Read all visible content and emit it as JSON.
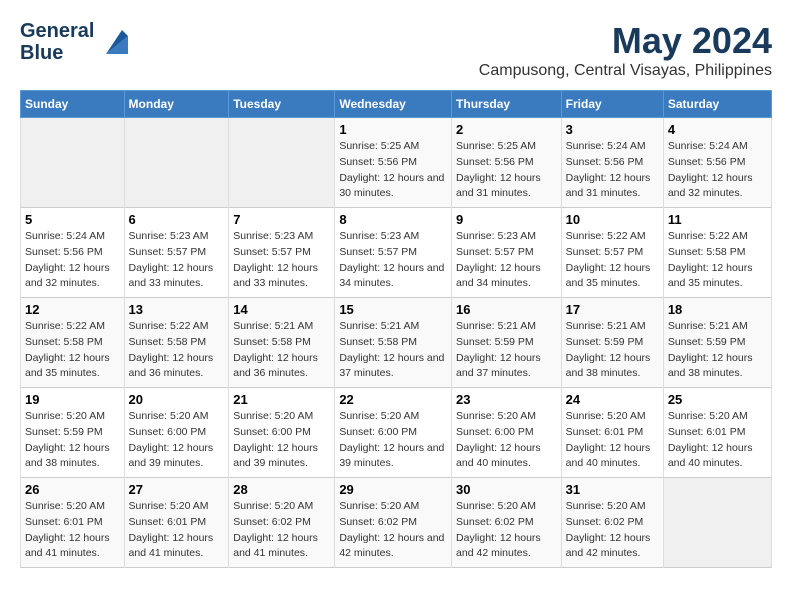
{
  "logo": {
    "line1": "General",
    "line2": "Blue"
  },
  "title": "May 2024",
  "subtitle": "Campusong, Central Visayas, Philippines",
  "days_of_week": [
    "Sunday",
    "Monday",
    "Tuesday",
    "Wednesday",
    "Thursday",
    "Friday",
    "Saturday"
  ],
  "weeks": [
    [
      {
        "day": "",
        "sunrise": "",
        "sunset": "",
        "daylight": "",
        "empty": true
      },
      {
        "day": "",
        "sunrise": "",
        "sunset": "",
        "daylight": "",
        "empty": true
      },
      {
        "day": "",
        "sunrise": "",
        "sunset": "",
        "daylight": "",
        "empty": true
      },
      {
        "day": "1",
        "sunrise": "5:25 AM",
        "sunset": "5:56 PM",
        "daylight": "12 hours and 30 minutes."
      },
      {
        "day": "2",
        "sunrise": "5:25 AM",
        "sunset": "5:56 PM",
        "daylight": "12 hours and 31 minutes."
      },
      {
        "day": "3",
        "sunrise": "5:24 AM",
        "sunset": "5:56 PM",
        "daylight": "12 hours and 31 minutes."
      },
      {
        "day": "4",
        "sunrise": "5:24 AM",
        "sunset": "5:56 PM",
        "daylight": "12 hours and 32 minutes."
      }
    ],
    [
      {
        "day": "5",
        "sunrise": "5:24 AM",
        "sunset": "5:56 PM",
        "daylight": "12 hours and 32 minutes."
      },
      {
        "day": "6",
        "sunrise": "5:23 AM",
        "sunset": "5:57 PM",
        "daylight": "12 hours and 33 minutes."
      },
      {
        "day": "7",
        "sunrise": "5:23 AM",
        "sunset": "5:57 PM",
        "daylight": "12 hours and 33 minutes."
      },
      {
        "day": "8",
        "sunrise": "5:23 AM",
        "sunset": "5:57 PM",
        "daylight": "12 hours and 34 minutes."
      },
      {
        "day": "9",
        "sunrise": "5:23 AM",
        "sunset": "5:57 PM",
        "daylight": "12 hours and 34 minutes."
      },
      {
        "day": "10",
        "sunrise": "5:22 AM",
        "sunset": "5:57 PM",
        "daylight": "12 hours and 35 minutes."
      },
      {
        "day": "11",
        "sunrise": "5:22 AM",
        "sunset": "5:58 PM",
        "daylight": "12 hours and 35 minutes."
      }
    ],
    [
      {
        "day": "12",
        "sunrise": "5:22 AM",
        "sunset": "5:58 PM",
        "daylight": "12 hours and 35 minutes."
      },
      {
        "day": "13",
        "sunrise": "5:22 AM",
        "sunset": "5:58 PM",
        "daylight": "12 hours and 36 minutes."
      },
      {
        "day": "14",
        "sunrise": "5:21 AM",
        "sunset": "5:58 PM",
        "daylight": "12 hours and 36 minutes."
      },
      {
        "day": "15",
        "sunrise": "5:21 AM",
        "sunset": "5:58 PM",
        "daylight": "12 hours and 37 minutes."
      },
      {
        "day": "16",
        "sunrise": "5:21 AM",
        "sunset": "5:59 PM",
        "daylight": "12 hours and 37 minutes."
      },
      {
        "day": "17",
        "sunrise": "5:21 AM",
        "sunset": "5:59 PM",
        "daylight": "12 hours and 38 minutes."
      },
      {
        "day": "18",
        "sunrise": "5:21 AM",
        "sunset": "5:59 PM",
        "daylight": "12 hours and 38 minutes."
      }
    ],
    [
      {
        "day": "19",
        "sunrise": "5:20 AM",
        "sunset": "5:59 PM",
        "daylight": "12 hours and 38 minutes."
      },
      {
        "day": "20",
        "sunrise": "5:20 AM",
        "sunset": "6:00 PM",
        "daylight": "12 hours and 39 minutes."
      },
      {
        "day": "21",
        "sunrise": "5:20 AM",
        "sunset": "6:00 PM",
        "daylight": "12 hours and 39 minutes."
      },
      {
        "day": "22",
        "sunrise": "5:20 AM",
        "sunset": "6:00 PM",
        "daylight": "12 hours and 39 minutes."
      },
      {
        "day": "23",
        "sunrise": "5:20 AM",
        "sunset": "6:00 PM",
        "daylight": "12 hours and 40 minutes."
      },
      {
        "day": "24",
        "sunrise": "5:20 AM",
        "sunset": "6:01 PM",
        "daylight": "12 hours and 40 minutes."
      },
      {
        "day": "25",
        "sunrise": "5:20 AM",
        "sunset": "6:01 PM",
        "daylight": "12 hours and 40 minutes."
      }
    ],
    [
      {
        "day": "26",
        "sunrise": "5:20 AM",
        "sunset": "6:01 PM",
        "daylight": "12 hours and 41 minutes."
      },
      {
        "day": "27",
        "sunrise": "5:20 AM",
        "sunset": "6:01 PM",
        "daylight": "12 hours and 41 minutes."
      },
      {
        "day": "28",
        "sunrise": "5:20 AM",
        "sunset": "6:02 PM",
        "daylight": "12 hours and 41 minutes."
      },
      {
        "day": "29",
        "sunrise": "5:20 AM",
        "sunset": "6:02 PM",
        "daylight": "12 hours and 42 minutes."
      },
      {
        "day": "30",
        "sunrise": "5:20 AM",
        "sunset": "6:02 PM",
        "daylight": "12 hours and 42 minutes."
      },
      {
        "day": "31",
        "sunrise": "5:20 AM",
        "sunset": "6:02 PM",
        "daylight": "12 hours and 42 minutes."
      },
      {
        "day": "",
        "sunrise": "",
        "sunset": "",
        "daylight": "",
        "empty": true
      }
    ]
  ],
  "labels": {
    "sunrise_prefix": "Sunrise: ",
    "sunset_prefix": "Sunset: ",
    "daylight_prefix": "Daylight: "
  }
}
